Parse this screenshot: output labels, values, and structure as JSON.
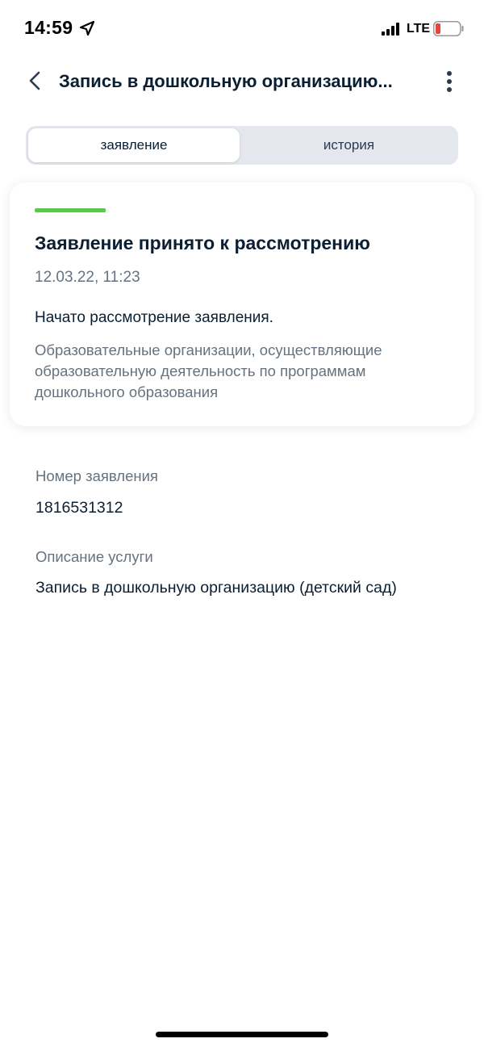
{
  "status_bar": {
    "time": "14:59",
    "network": "LTE",
    "icons": [
      "location-arrow-icon",
      "signal-icon",
      "battery-low-icon"
    ],
    "battery_color": "#e5473b"
  },
  "header": {
    "title": "Запись в дошкольную организацию...",
    "back_icon": "chevron-left-icon",
    "menu_icon": "more-vertical-icon"
  },
  "tabs": [
    {
      "label": "заявление",
      "active": true
    },
    {
      "label": "история",
      "active": false
    }
  ],
  "status_card": {
    "accent_color": "#5fc451",
    "title": "Заявление принято к рассмотрению",
    "date": "12.03.22, 11:23",
    "message": "Начато рассмотрение заявления.",
    "organization": "Образовательные организации, осуществляющие образовательную деятельность по программам дошкольного образования"
  },
  "details": {
    "application_number_label": "Номер заявления",
    "application_number": "1816531312",
    "service_description_label": "Описание услуги",
    "service_description": "Запись в дошкольную организацию (детский сад)"
  }
}
